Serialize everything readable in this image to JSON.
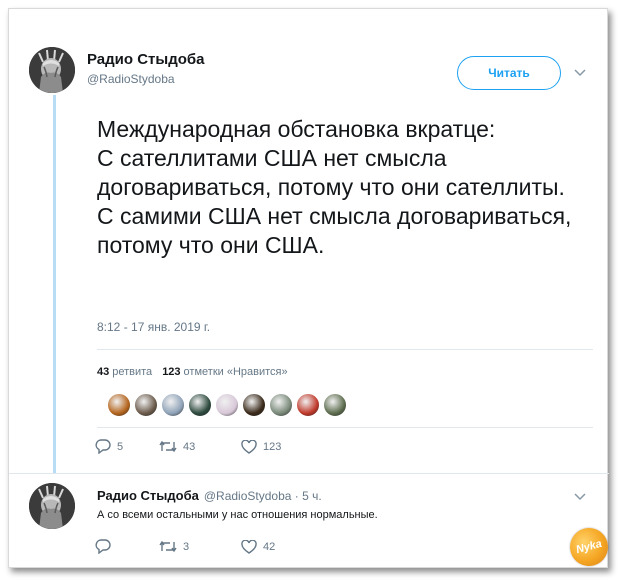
{
  "tweet": {
    "author_name": "Радио Стыдоба",
    "author_handle": "@RadioStydoba",
    "follow_label": "Читать",
    "text": "Международная обстановка вкратце:\nС сателлитами США нет смысла договариваться, потому что они сателлиты.\nС самими США нет смысла договариваться, потому что они США.",
    "timestamp": "8:12 - 17 янв. 2019 г.",
    "retweets_count": "43",
    "retweets_label": "ретвита",
    "likes_count": "123",
    "likes_label": "отметки «Нравится»",
    "liker_colors": [
      "#b5651d",
      "#6b5b4b",
      "#8fa3b8",
      "#2d4a3e",
      "#d8c8d8",
      "#3a2a1a",
      "#7a8a7a",
      "#c0392b",
      "#5d6d4e"
    ],
    "actions": {
      "reply": "5",
      "retweet": "43",
      "like": "123"
    }
  },
  "reply": {
    "author_name": "Радио Стыдоба",
    "author_handle": "@RadioStydoba · 5 ч.",
    "text": "А со всеми остальными у нас отношения нормальные.",
    "actions": {
      "reply": "",
      "retweet": "3",
      "like": "42"
    }
  },
  "watermark": {
    "text": "Nyka"
  },
  "colors": {
    "accent": "#1da1f2",
    "thread_line": "#b6dcf6",
    "secondary_text": "#657786"
  }
}
